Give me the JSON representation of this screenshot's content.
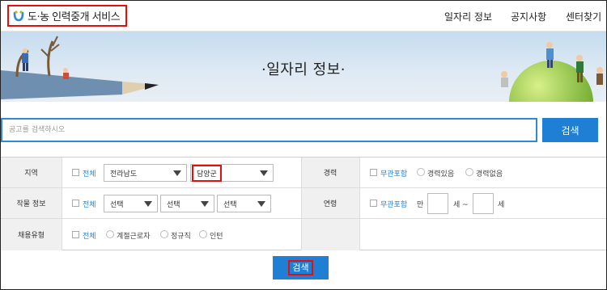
{
  "brand": {
    "logo_text": "도·농 인력중개 서비스"
  },
  "nav": {
    "items": [
      "일자리 정보",
      "공지사항",
      "센터찾기"
    ]
  },
  "hero": {
    "title": "·일자리 정보·"
  },
  "search": {
    "placeholder": "공고를 검색하시오",
    "button_label": "검색"
  },
  "filters": {
    "region": {
      "label": "지역",
      "all_label": "전체",
      "province_value": "전라남도",
      "county_value": "담양군"
    },
    "experience": {
      "label": "경력",
      "options": [
        "무관포함",
        "경력있음",
        "경력없음"
      ]
    },
    "crop": {
      "label": "작물 정보",
      "all_label": "전체",
      "selects": [
        "선택",
        "선택",
        "선택"
      ]
    },
    "age": {
      "label": "연령",
      "any_label": "무관포함",
      "min_prefix": "만",
      "unit_1": "세 ~",
      "unit_2": "세"
    },
    "employment": {
      "label": "채용유형",
      "all_label": "전체",
      "options": [
        "계절근로자",
        "정규직",
        "인턴"
      ]
    }
  },
  "submit": {
    "label": "검색"
  },
  "colors": {
    "accent": "#1e7fd4",
    "highlight": "#e01010"
  }
}
